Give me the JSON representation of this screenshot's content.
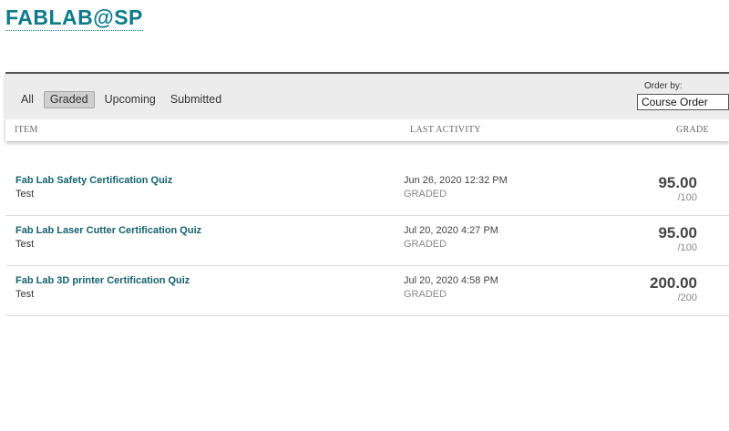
{
  "course": {
    "title": "FABLAB@SP"
  },
  "filters": {
    "items": [
      {
        "label": "All",
        "active": false
      },
      {
        "label": "Graded",
        "active": true
      },
      {
        "label": "Upcoming",
        "active": false
      },
      {
        "label": "Submitted",
        "active": false
      }
    ]
  },
  "order": {
    "label": "Order by:",
    "selected": "Course Order"
  },
  "columns": {
    "item": "ITEM",
    "last_activity": "LAST ACTIVITY",
    "grade": "GRADE"
  },
  "rows": [
    {
      "title": "Fab Lab Safety Certification Quiz",
      "subtitle": "Test",
      "date": "Jun 26, 2020 12:32 PM",
      "status": "GRADED",
      "score": "95.00",
      "max": "/100"
    },
    {
      "title": "Fab Lab Laser Cutter Certification Quiz",
      "subtitle": "Test",
      "date": "Jul 20, 2020 4:27 PM",
      "status": "GRADED",
      "score": "95.00",
      "max": "/100"
    },
    {
      "title": "Fab Lab 3D printer Certification Quiz",
      "subtitle": "Test",
      "date": "Jul 20, 2020 4:58 PM",
      "status": "GRADED",
      "score": "200.00",
      "max": "/200"
    }
  ],
  "colors": {
    "title": "#0e7a8a",
    "link": "#14626f",
    "panel": "#ececec"
  }
}
